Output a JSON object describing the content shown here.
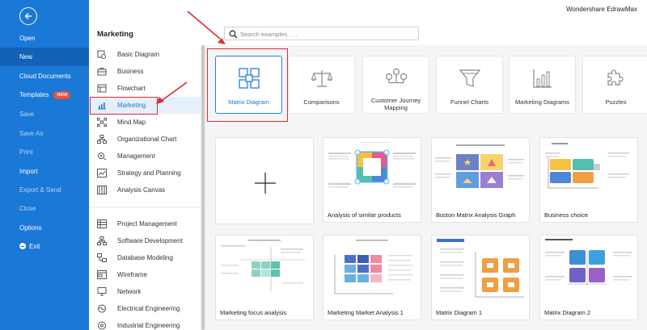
{
  "app_title": "Wondershare EdrawMax",
  "leftnav": {
    "items": [
      "Open",
      "New",
      "Cloud Documents",
      "Templates",
      "Save",
      "Save As",
      "Print",
      "Import",
      "Export & Send",
      "Close",
      "Options",
      "Exit"
    ],
    "templates_badge": "NEW",
    "active": "New"
  },
  "section_title": "Marketing",
  "search": {
    "placeholder": "Search examples . . ."
  },
  "categories": [
    {
      "label": "Basic Diagram",
      "icon": "basic-diagram-icon"
    },
    {
      "label": "Business",
      "icon": "briefcase-icon"
    },
    {
      "label": "Flowchart",
      "icon": "flowchart-icon"
    },
    {
      "label": "Marketing",
      "icon": "bar-chart-icon"
    },
    {
      "label": "Mind Map",
      "icon": "mind-map-icon"
    },
    {
      "label": "Organizational Chart",
      "icon": "org-chart-icon"
    },
    {
      "label": "Management",
      "icon": "management-icon"
    },
    {
      "label": "Strategy and Planning",
      "icon": "strategy-icon"
    },
    {
      "label": "Analysis Canvas",
      "icon": "canvas-icon"
    },
    {
      "label": "Project Management",
      "icon": "project-icon"
    },
    {
      "label": "Software Development",
      "icon": "software-icon"
    },
    {
      "label": "Database Modeling",
      "icon": "database-icon"
    },
    {
      "label": "Wireframe",
      "icon": "wireframe-icon"
    },
    {
      "label": "Network",
      "icon": "network-icon"
    },
    {
      "label": "Electrical Engineering",
      "icon": "electrical-icon"
    },
    {
      "label": "Industrial Engineering",
      "icon": "industrial-icon"
    }
  ],
  "selected_category": "Marketing",
  "template_types": [
    {
      "label": "Matrix Diagram",
      "icon": "matrix-icon"
    },
    {
      "label": "Comparisons",
      "icon": "scales-icon"
    },
    {
      "label": "Customer Journey Mapping",
      "icon": "journey-icon"
    },
    {
      "label": "Funnel Charts",
      "icon": "funnel-icon"
    },
    {
      "label": "Marketing Diagrams",
      "icon": "bar-chart-icon"
    },
    {
      "label": "Puzzles",
      "icon": "puzzle-icon"
    }
  ],
  "selected_type": "Matrix Diagram",
  "templates": [
    {
      "label": ""
    },
    {
      "label": "Analysis of similar products"
    },
    {
      "label": "Boston Matrix Analysis Graph"
    },
    {
      "label": "Business choice"
    },
    {
      "label": "Marketing focus analysis"
    },
    {
      "label": "Marketing Market Analysis 1"
    },
    {
      "label": "Matrix Diagram 1"
    },
    {
      "label": "Matrix Diagram 2"
    }
  ],
  "colors": {
    "nav_blue": "#1a78d6",
    "nav_active": "#1262b7",
    "badge_red": "#e5533d",
    "highlight_red": "#e02b2b"
  }
}
